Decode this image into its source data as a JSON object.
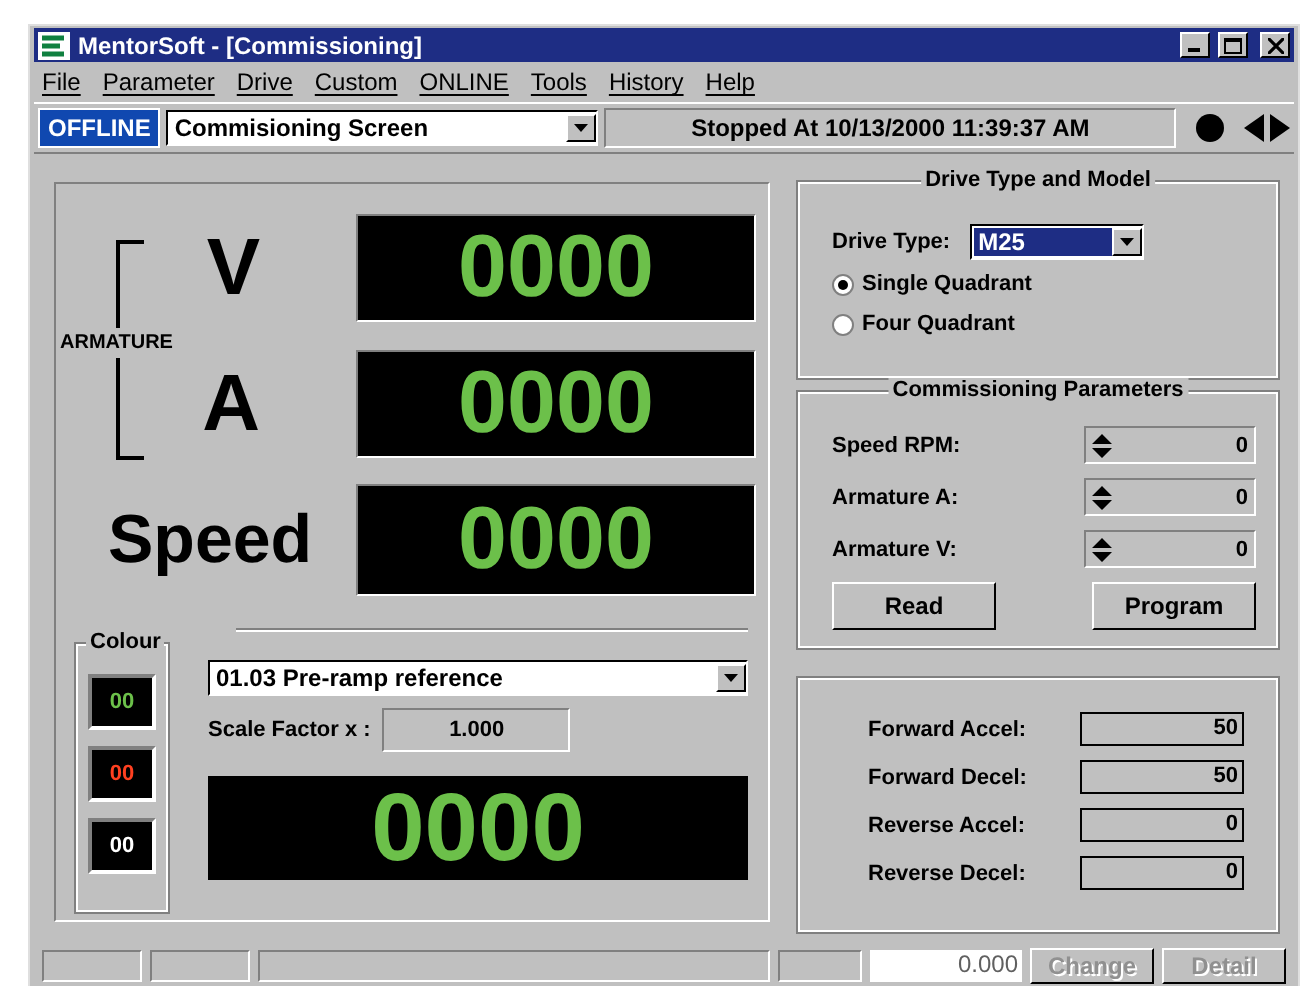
{
  "window": {
    "title": "MentorSoft - [Commissioning]"
  },
  "menu": [
    "File",
    "Parameter",
    "Drive",
    "Custom",
    "ONLINE",
    "Tools",
    "History",
    "Help"
  ],
  "toolbar": {
    "mode": "OFFLINE",
    "screen": "Commisioning Screen",
    "status": "Stopped At 10/13/2000 11:39:37 AM"
  },
  "meters": {
    "armature_label": "ARMATURE",
    "displays": [
      {
        "kind": "small",
        "label": "V",
        "value": "0000"
      },
      {
        "kind": "small",
        "label": "A",
        "value": "0000"
      },
      {
        "kind": "large",
        "label": "Speed",
        "value": "0000"
      }
    ]
  },
  "colour": {
    "title": "Colour",
    "swatches": [
      {
        "text": "00",
        "color": "#6cc04a"
      },
      {
        "text": "00",
        "color": "#ff4020"
      },
      {
        "text": "00",
        "color": "#ffffff"
      }
    ]
  },
  "parameter": {
    "selection": "01.03  Pre-ramp reference",
    "scale_label": "Scale Factor x :",
    "scale_value": "1.000",
    "value": "0000"
  },
  "drive_type": {
    "title": "Drive Type and Model",
    "label": "Drive Type:",
    "value": "M25",
    "options": [
      {
        "label": "Single Quadrant",
        "selected": true
      },
      {
        "label": "Four Quadrant",
        "selected": false
      }
    ]
  },
  "commissioning": {
    "title": "Commissioning Parameters",
    "fields": [
      {
        "label": "Speed RPM:",
        "value": "0"
      },
      {
        "label": "Armature A:",
        "value": "0"
      },
      {
        "label": "Armature V:",
        "value": "0"
      }
    ],
    "buttons": [
      "Read",
      "Program"
    ]
  },
  "ramps": [
    {
      "label": "Forward Accel:",
      "value": "50"
    },
    {
      "label": "Forward Decel:",
      "value": "50"
    },
    {
      "label": "Reverse Accel:",
      "value": "0"
    },
    {
      "label": "Reverse Decel:",
      "value": "0"
    }
  ],
  "status_bar": {
    "value": "0.000",
    "buttons": [
      "Change",
      "Detail"
    ]
  }
}
